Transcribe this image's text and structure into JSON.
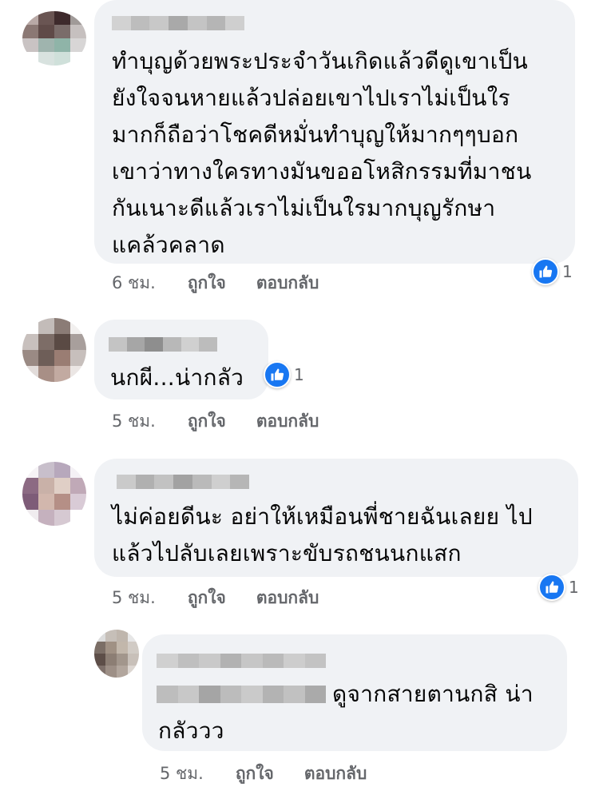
{
  "colors": {
    "bubble": "#f0f2f5",
    "text": "#050505",
    "meta": "#65676b",
    "like_blue": "#1877f2"
  },
  "comments": [
    {
      "text": "ทำบุญด้วยพระประจำวันเกิดแล้วดีดูเขาเป็น\nยังใจจนหายแล้วปล่อยเขาไปเราไม่เป็นใร\nมากก็ถือว่าโชคดีหมั่นทำบุญให้มากๆๆบอก\nเขาว่าทางใครทางมันขออโหสิกรรมที่มาชน\nกันเนาะดีแล้วเราไม่เป็นใรมากบุญรักษา\nแคล้วคลาด",
      "time": "6 ชม.",
      "like": "ถูกใจ",
      "reply": "ตอบกลับ",
      "reaction_count": "1",
      "reaction_icon": "thumbs-up-icon"
    },
    {
      "text": "นกผี...น่ากลัว",
      "time": "5 ชม.",
      "like": "ถูกใจ",
      "reply": "ตอบกลับ",
      "reaction_count": "1",
      "reaction_icon": "thumbs-up-icon"
    },
    {
      "text": "ไม่ค่อยดีนะ อย่าให้เหมือนพี่ชายฉันเลยย ไป\nแล้วไปลับเลยเพราะขับรถชนนกแสก",
      "time": "5 ชม.",
      "like": "ถูกใจ",
      "reply": "ตอบกลับ",
      "reaction_count": "1",
      "reaction_icon": "thumbs-up-icon"
    },
    {
      "text": "ดูจากสายตานกสิ น่า",
      "text_line2": "กลัววว",
      "time": "5 ชม.",
      "like": "ถูกใจ",
      "reply": "ตอบกลับ"
    }
  ]
}
